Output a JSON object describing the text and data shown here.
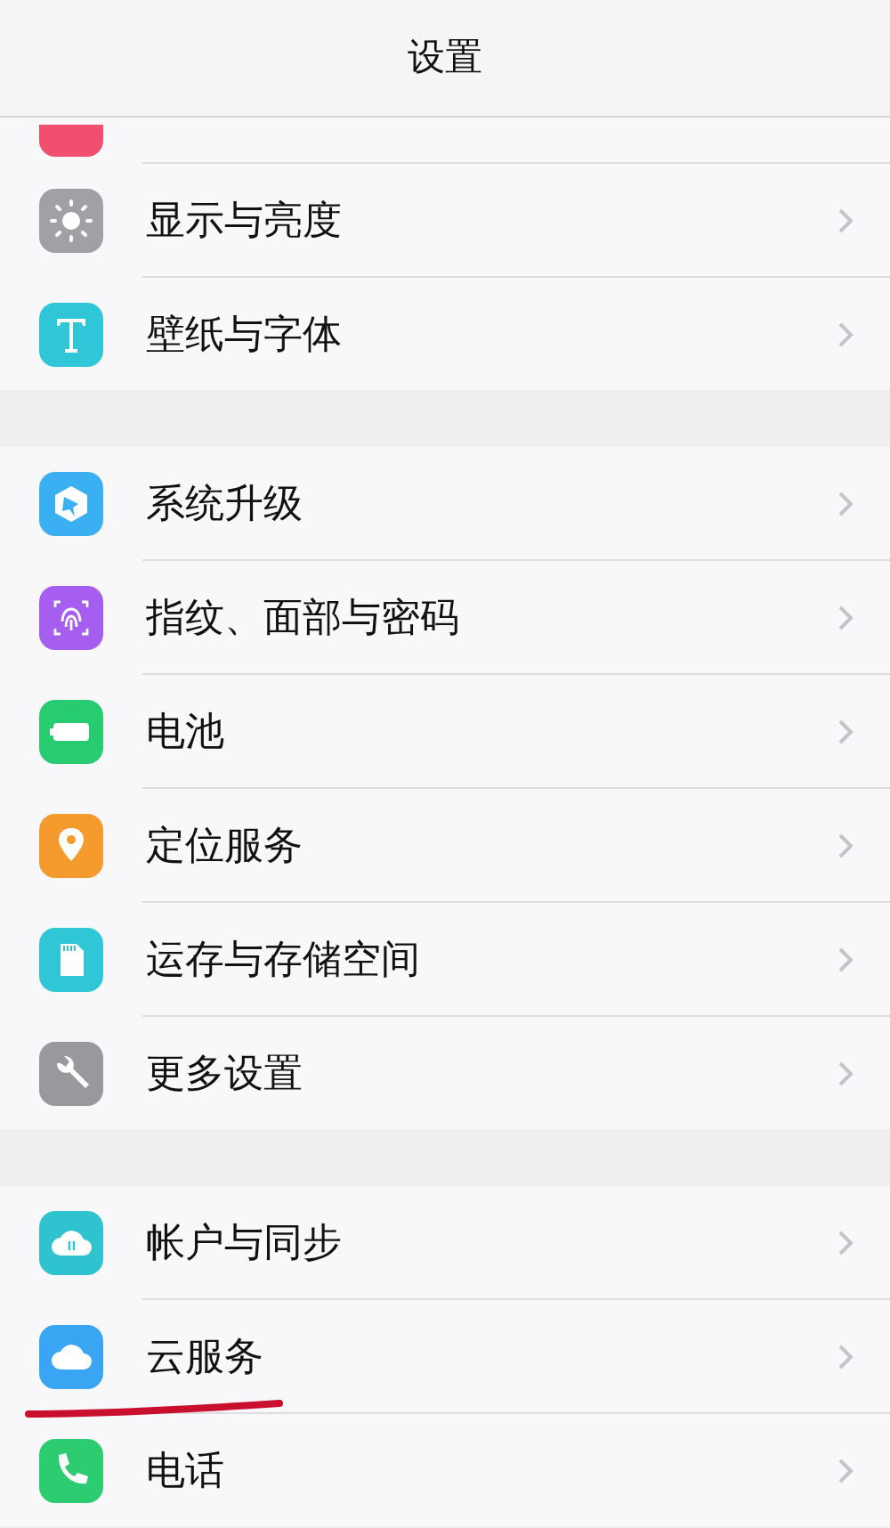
{
  "header": {
    "title": "设置"
  },
  "groups": [
    {
      "items": [
        {
          "kind": "sound",
          "cut": true
        },
        {
          "kind": "display",
          "label": "显示与亮度"
        },
        {
          "kind": "wallpaper",
          "label": "壁纸与字体"
        }
      ]
    },
    {
      "items": [
        {
          "kind": "update",
          "label": "系统升级"
        },
        {
          "kind": "fingerprint",
          "label": "指纹、面部与密码"
        },
        {
          "kind": "battery",
          "label": "电池"
        },
        {
          "kind": "location",
          "label": "定位服务"
        },
        {
          "kind": "storage",
          "label": "运存与存储空间"
        },
        {
          "kind": "more",
          "label": "更多设置"
        }
      ]
    },
    {
      "items": [
        {
          "kind": "account",
          "label": "帐户与同步"
        },
        {
          "kind": "cloud",
          "label": "云服务",
          "underlined": true
        },
        {
          "kind": "phone",
          "label": "电话"
        }
      ]
    }
  ]
}
